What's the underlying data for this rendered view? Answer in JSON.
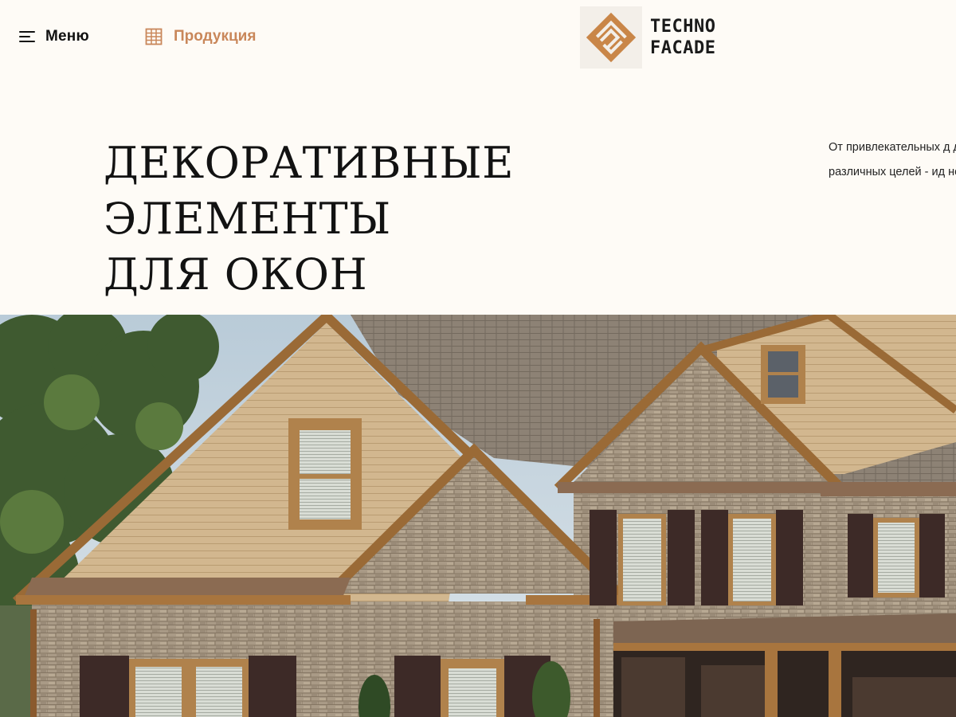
{
  "header": {
    "menu_label": "Меню",
    "products_label": "Продукция",
    "logo_line1": "TECHNO",
    "logo_line2": "FACADE"
  },
  "hero": {
    "title_line1": "ДЕКОРАТИВНЫЕ ЭЛЕМЕНТЫ",
    "title_line2": "ДЛЯ ОКОН",
    "description": "От привлекательных д дверных и оконных но различных целей - ид неограниченные возм"
  },
  "icons": {
    "menu": "hamburger-icon",
    "products": "building-icon",
    "logo": "techno-facade-logo"
  },
  "colors": {
    "background": "#fefbf6",
    "accent": "#c9875a",
    "logo_accent": "#c98648",
    "text": "#111111"
  }
}
